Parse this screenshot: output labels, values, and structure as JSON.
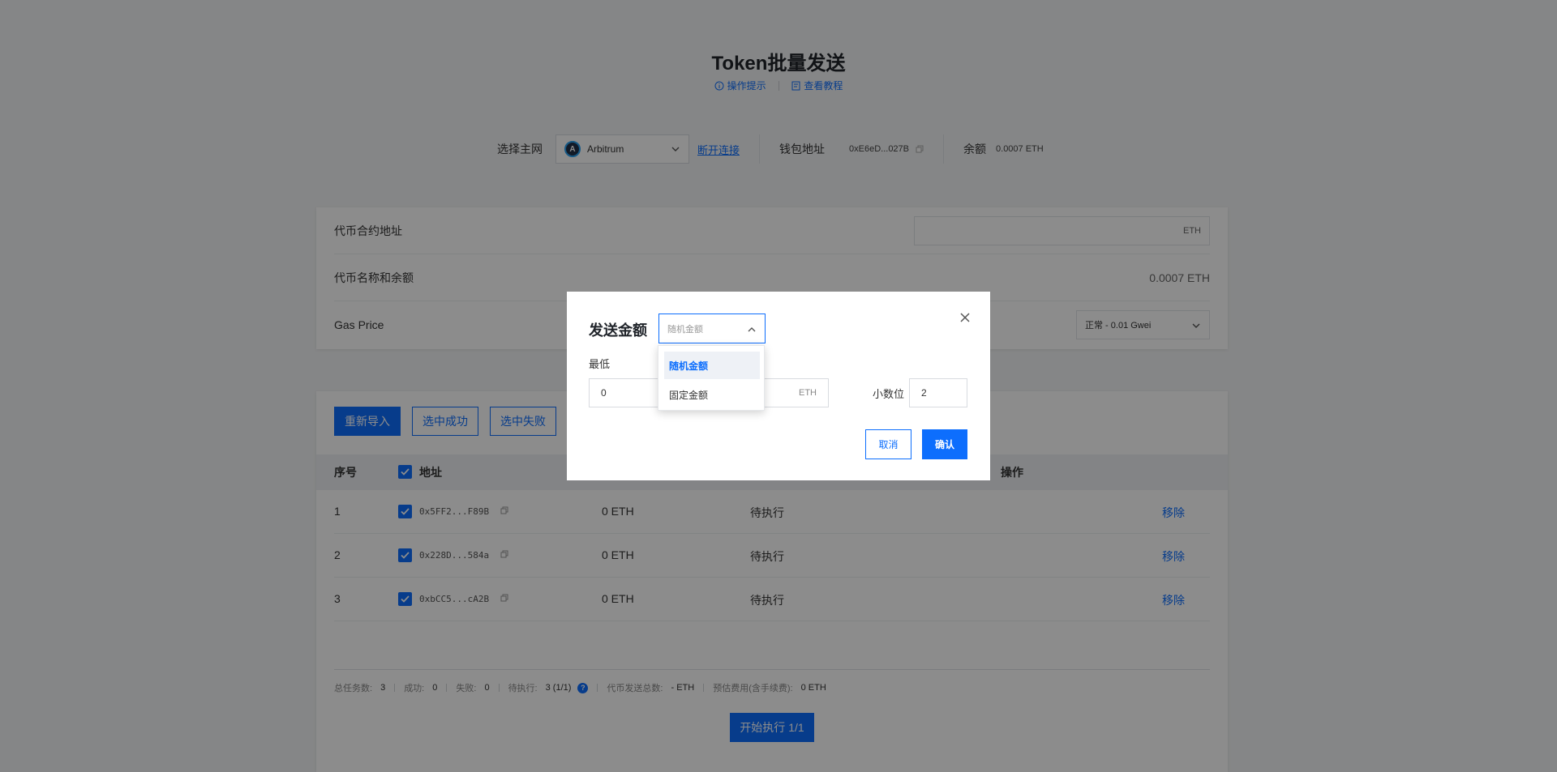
{
  "header": {
    "title": "Token批量发送",
    "link_tips": "操作提示",
    "link_tutorial": "查看教程"
  },
  "network_bar": {
    "select_label": "选择主网",
    "network_value": "Arbitrum",
    "disconnect_label": "断开连接",
    "wallet_label": "钱包地址",
    "wallet_value": "0xE6eD...027B",
    "balance_label": "余额",
    "balance_value": "0.0007 ETH"
  },
  "token_form": {
    "contract_label": "代币合约地址",
    "contract_suffix": "ETH",
    "name_balance_label": "代币名称和余额",
    "name_balance_value": "0.0007 ETH",
    "gas_label": "Gas Price",
    "gas_value": "正常 - 0.01 Gwei"
  },
  "toolbar": {
    "reimport": "重新导入",
    "select_success": "选中成功",
    "select_fail": "选中失败"
  },
  "table": {
    "col_index": "序号",
    "col_address": "地址",
    "col_action": "操作",
    "rows": [
      {
        "index": "1",
        "address": "0x5FF2...F89B",
        "amount": "0 ETH",
        "status": "待执行",
        "action": "移除"
      },
      {
        "index": "2",
        "address": "0x228D...584a",
        "amount": "0 ETH",
        "status": "待执行",
        "action": "移除"
      },
      {
        "index": "3",
        "address": "0xbCC5...cA2B",
        "amount": "0 ETH",
        "status": "待执行",
        "action": "移除"
      }
    ]
  },
  "stats": {
    "total_label": "总任务数:",
    "total_value": "3",
    "success_label": "成功:",
    "success_value": "0",
    "fail_label": "失败:",
    "fail_value": "0",
    "pending_label": "待执行:",
    "pending_value": "3 (1/1)",
    "sent_label": "代币发送总数:",
    "sent_value": "- ETH",
    "fee_label": "预估费用(含手续费):",
    "fee_value": "0 ETH",
    "help_glyph": "?"
  },
  "start_button": "开始执行 1/1",
  "modal": {
    "title": "发送金额",
    "amount_type_placeholder": "随机金额",
    "min_label": "最低",
    "min_value": "0",
    "max_suffix": "ETH",
    "decimals_label": "小数位",
    "decimals_value": "2",
    "cancel": "取消",
    "confirm": "确认",
    "dropdown": {
      "options": [
        "随机金额",
        "固定金额"
      ],
      "selected": "随机金额"
    }
  },
  "colors": {
    "accent": "#0d6efd",
    "overlay": "rgba(0,0,0,0.45)"
  }
}
